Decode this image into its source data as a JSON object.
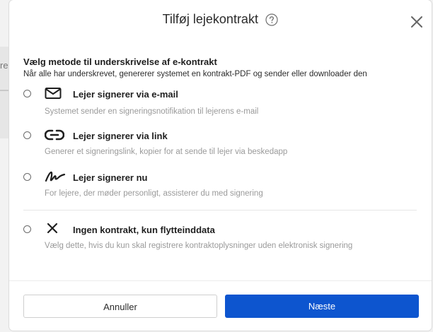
{
  "background": {
    "side_text": "re"
  },
  "dialog": {
    "title": "Tilføj lejekontrakt",
    "help_icon": "question-circle-icon",
    "close_icon": "close-icon",
    "heading": "Vælg metode til underskrivelse af e-kontrakt",
    "subheading": "Når alle har underskrevet, genererer systemet en kontrakt-PDF og sender eller downloader den",
    "options": [
      {
        "icon": "envelope-icon",
        "label": "Lejer signerer via e-mail",
        "description": "Systemet sender en signeringsnotifikation til lejerens e-mail",
        "selected": false
      },
      {
        "icon": "link-icon",
        "label": "Lejer signerer via link",
        "description": "Generer et signeringslink, kopier for at sende til lejer via beskedapp",
        "selected": false
      },
      {
        "icon": "signature-icon",
        "label": "Lejer signerer nu",
        "description": "For lejere, der møder personligt, assisterer du med signering",
        "selected": false
      },
      {
        "icon": "x-icon",
        "label": "Ingen kontrakt, kun flytteinddata",
        "description": "Vælg dette, hvis du kun skal registrere kontraktoplysninger uden elektronisk signering",
        "selected": false
      }
    ],
    "cancel_label": "Annuller",
    "next_label": "Næste",
    "colors": {
      "primary": "#0d55cf",
      "muted_text": "#9a9a9a"
    }
  }
}
